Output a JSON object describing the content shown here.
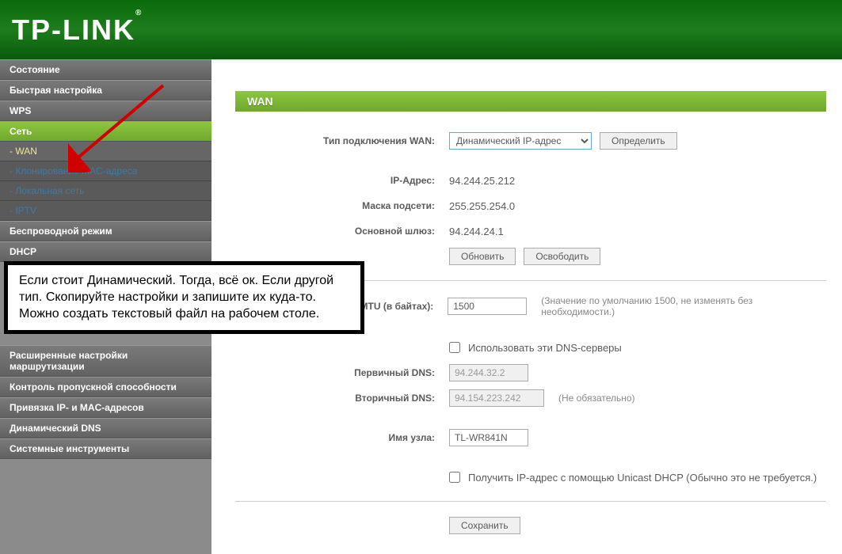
{
  "logo": "TP-LINK",
  "sidebar": {
    "items": [
      {
        "label": "Состояние",
        "type": "item"
      },
      {
        "label": "Быстрая настройка",
        "type": "item"
      },
      {
        "label": "WPS",
        "type": "item"
      },
      {
        "label": "Сеть",
        "type": "parent-active"
      },
      {
        "label": "- WAN",
        "type": "sub-active"
      },
      {
        "label": "- Клонирование MAC-адреса",
        "type": "sub"
      },
      {
        "label": "- Локальная сеть",
        "type": "sub"
      },
      {
        "label": "- IPTV",
        "type": "sub"
      },
      {
        "label": "Беспроводной режим",
        "type": "item"
      },
      {
        "label": "DHCP",
        "type": "item"
      },
      {
        "label": "Расширенные настройки маршрутизации",
        "type": "item"
      },
      {
        "label": "Контроль пропускной способности",
        "type": "item"
      },
      {
        "label": "Привязка IP- и MAC-адресов",
        "type": "item"
      },
      {
        "label": "Динамический DNS",
        "type": "item"
      },
      {
        "label": "Системные инструменты",
        "type": "item"
      }
    ]
  },
  "page": {
    "title": "WAN",
    "labels": {
      "conn_type": "Тип подключения WAN:",
      "ip": "IP-Адрес:",
      "mask": "Маска подсети:",
      "gateway": "Основной шлюз:",
      "mtu": "азмер MTU (в байтах):",
      "dns1": "Первичный DNS:",
      "dns2": "Вторичный DNS:",
      "hostname": "Имя узла:"
    },
    "values": {
      "conn_type": "Динамический IP-адрес",
      "ip": "94.244.25.212",
      "mask": "255.255.254.0",
      "gateway": "94.244.24.1",
      "mtu": "1500",
      "dns1": "94.244.32.2",
      "dns2": "94.154.223.242",
      "hostname": "TL-WR841N"
    },
    "buttons": {
      "detect": "Определить",
      "refresh": "Обновить",
      "release": "Освободить",
      "save": "Сохранить"
    },
    "hints": {
      "mtu": "(Значение по умолчанию 1500, не изменять без необходимости.)",
      "dns2": "(Не обязательно)"
    },
    "checkboxes": {
      "use_dns": "Использовать эти DNS-серверы",
      "unicast": "Получить IP-адрес с помощью Unicast DHCP (Обычно это не требуется.)"
    }
  },
  "annotation": "Если стоит Динамический. Тогда, всё ок. Если другой тип. Скопируйте настройки и запишите их куда-то. Можно создать текстовый файл на рабочем столе."
}
